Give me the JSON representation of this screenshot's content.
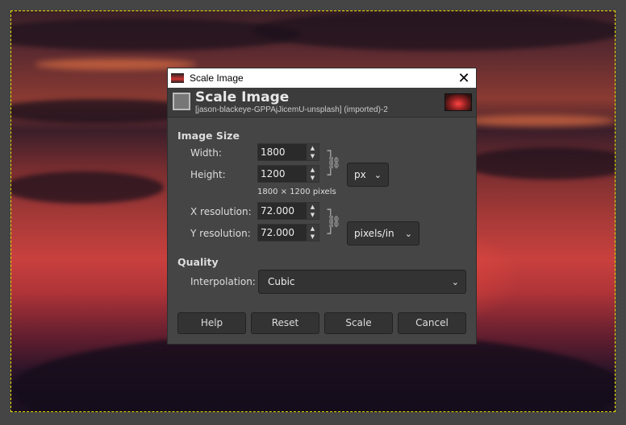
{
  "dialog": {
    "window_title": "Scale Image",
    "header_title": "Scale Image",
    "header_subtitle": "[jason-blackeye-GPPAjJicemU-unsplash] (imported)-2"
  },
  "image_size": {
    "section": "Image Size",
    "width_label": "Width:",
    "width_value": "1800",
    "height_label": "Height:",
    "height_value": "1200",
    "size_info": "1800 × 1200 pixels",
    "unit": "px",
    "xres_label": "X resolution:",
    "xres_value": "72.000",
    "yres_label": "Y resolution:",
    "yres_value": "72.000",
    "res_unit": "pixels/in"
  },
  "quality": {
    "section": "Quality",
    "interp_label": "Interpolation:",
    "interp_value": "Cubic"
  },
  "buttons": {
    "help": "Help",
    "reset": "Reset",
    "scale": "Scale",
    "cancel": "Cancel"
  },
  "colors": {
    "selection": "#e8e000",
    "dialog_bg": "#454545"
  }
}
